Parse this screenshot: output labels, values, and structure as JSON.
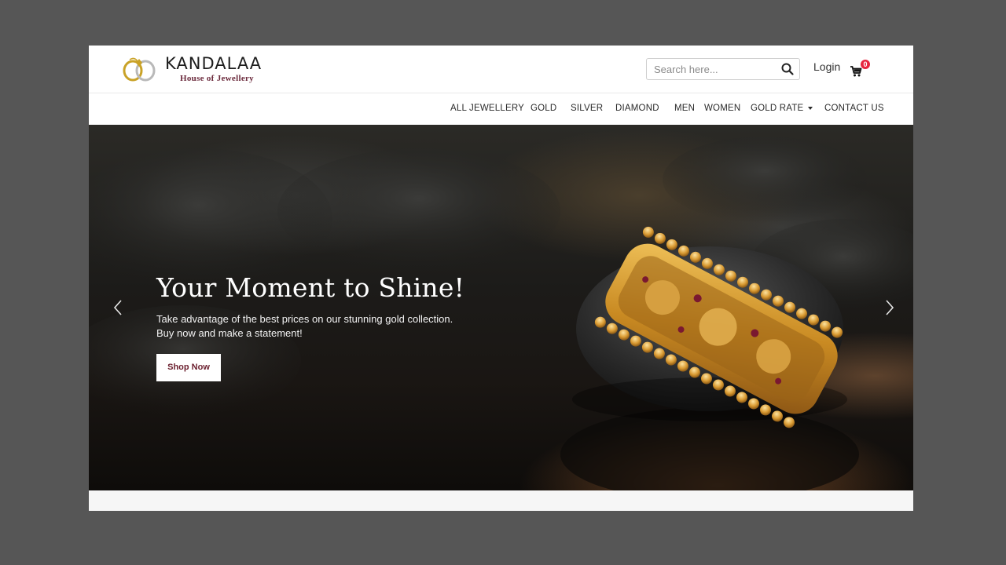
{
  "brand": {
    "name": "KANDALAA",
    "tagline": "House of Jewellery",
    "colors": {
      "accent": "#6b2a3c",
      "gold": "#c9a227",
      "badge": "#e7263f"
    }
  },
  "header": {
    "search_placeholder": "Search here...",
    "login_label": "Login",
    "cart_count": "0"
  },
  "nav": {
    "items": [
      {
        "label": "ALL JEWELLERY"
      },
      {
        "label": "GOLD"
      },
      {
        "label": "SILVER"
      },
      {
        "label": "DIAMOND"
      },
      {
        "label": "MEN"
      },
      {
        "label": "WOMEN"
      },
      {
        "label": "GOLD RATE"
      },
      {
        "label": "CONTACT US"
      }
    ]
  },
  "hero": {
    "title": "Your Moment to Shine!",
    "subtitle_line1": "Take advantage of the best prices on our stunning gold collection.",
    "subtitle_line2": "Buy now and make a statement!",
    "cta_label": "Shop Now"
  },
  "icons": {
    "search": "search-icon",
    "cart": "cart-icon",
    "prev": "chevron-left-icon",
    "next": "chevron-right-icon",
    "dropdown": "caret-down-icon"
  }
}
